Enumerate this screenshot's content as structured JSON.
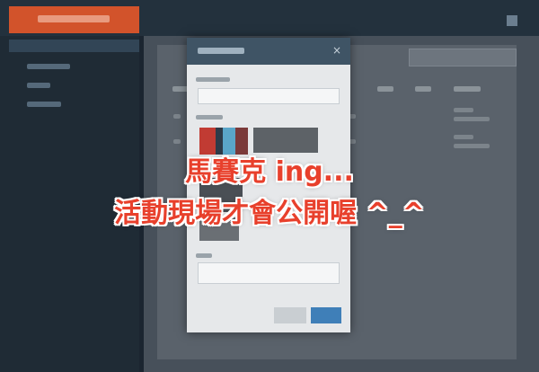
{
  "overlay": {
    "line1": "馬賽克 ing...",
    "line2": "活動現場才會公開喔 ^_^"
  },
  "modal": {
    "close_glyph": "×"
  },
  "colors": {
    "brand": "#d2532b",
    "overlay_text": "#e8402c",
    "primary_button": "#3f7fb8"
  }
}
